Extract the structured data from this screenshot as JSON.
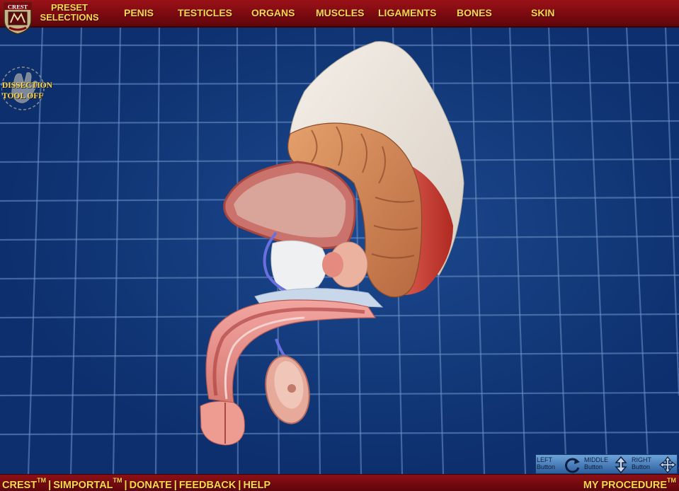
{
  "header": {
    "logo_text": "CREST",
    "preset_line1": "PRESET",
    "preset_line2": "SELECTIONS",
    "nav": [
      {
        "label": "PENIS"
      },
      {
        "label": "TESTICLES"
      },
      {
        "label": "ORGANS"
      },
      {
        "label": "MUSCLES"
      },
      {
        "label": "LIGAMENTS"
      },
      {
        "label": "BONES"
      },
      {
        "label": "SKIN"
      }
    ]
  },
  "dissection_tool": {
    "line1": "DISSECTION",
    "line2": "TOOL OFF",
    "icon": "hand-icon"
  },
  "mouse_legend": [
    {
      "line1": "LEFT",
      "line2": "Button",
      "icon": "rotate-icon"
    },
    {
      "line1": "MIDDLE",
      "line2": "Button",
      "icon": "zoom-arrows-icon"
    },
    {
      "line1": "RIGHT",
      "line2": "Button",
      "icon": "pan-arrows-icon"
    }
  ],
  "footer": {
    "crest": "CREST",
    "tm": "TM",
    "simportal": "SIMPORTAL",
    "donate": "DONATE",
    "feedback": "FEEDBACK",
    "help": "HELP",
    "separator": "|",
    "my_procedure": "MY PROCEDURE"
  },
  "colors": {
    "bar_red": "#7b0a10",
    "label_gold": "#ffd84a",
    "background_blue": "#0d2f6d",
    "grid_line": "#6f93c9"
  }
}
